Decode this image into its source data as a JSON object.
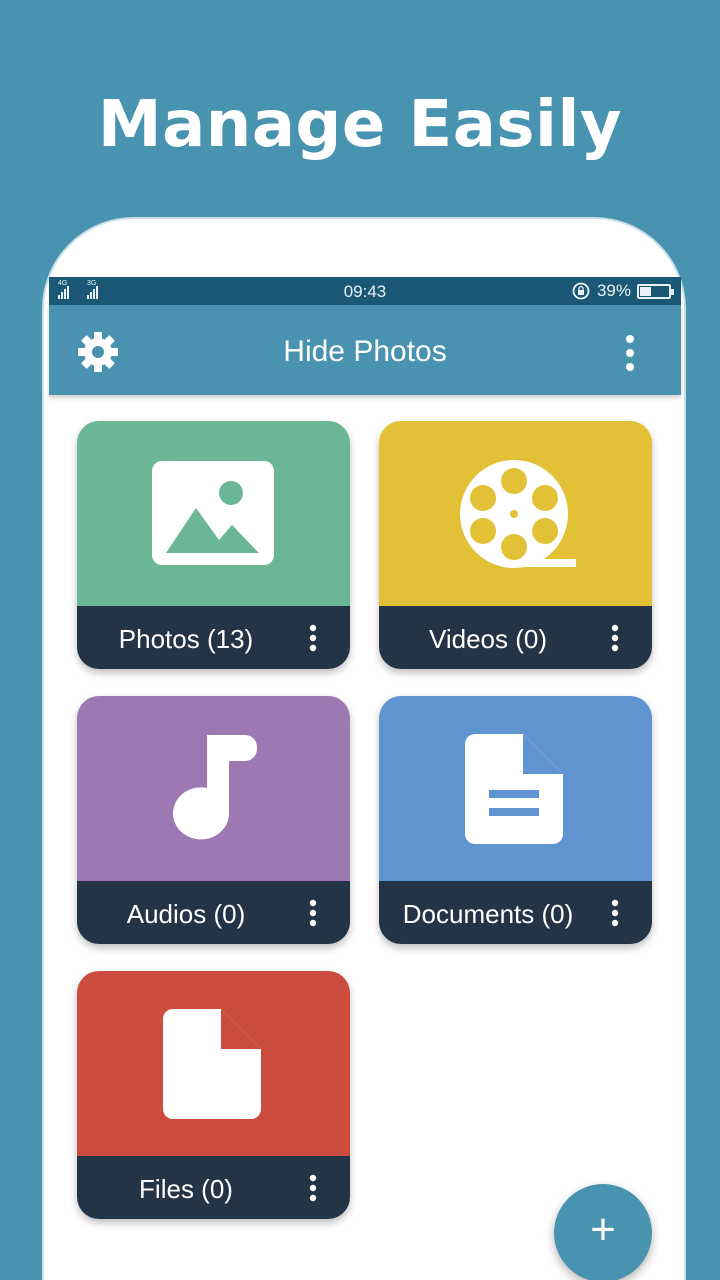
{
  "promo": {
    "headline": "Manage Easily"
  },
  "status_bar": {
    "network_1": "4G",
    "network_2": "3G",
    "time": "09:43",
    "battery_percent": "39%",
    "battery_level": 0.39,
    "icons": [
      "signal-icon",
      "rotation-lock-icon",
      "battery-icon"
    ]
  },
  "toolbar": {
    "title": "Hide Photos",
    "left_icon": "gear-icon",
    "right_icon": "more-vertical-icon"
  },
  "cards": [
    {
      "label": "Photos (13)",
      "color": "#6bb697",
      "icon": "image-icon"
    },
    {
      "label": "Videos (0)",
      "color": "#e2c136",
      "icon": "film-reel-icon"
    },
    {
      "label": "Audios (0)",
      "color": "#9c79b3",
      "icon": "music-note-icon"
    },
    {
      "label": "Documents (0)",
      "color": "#6094d0",
      "icon": "document-icon"
    },
    {
      "label": "Files (0)",
      "color": "#cc4d3f",
      "icon": "file-icon"
    }
  ],
  "card_footer_color": "#243447",
  "fab": {
    "label": "+",
    "color": "#4893b0"
  }
}
